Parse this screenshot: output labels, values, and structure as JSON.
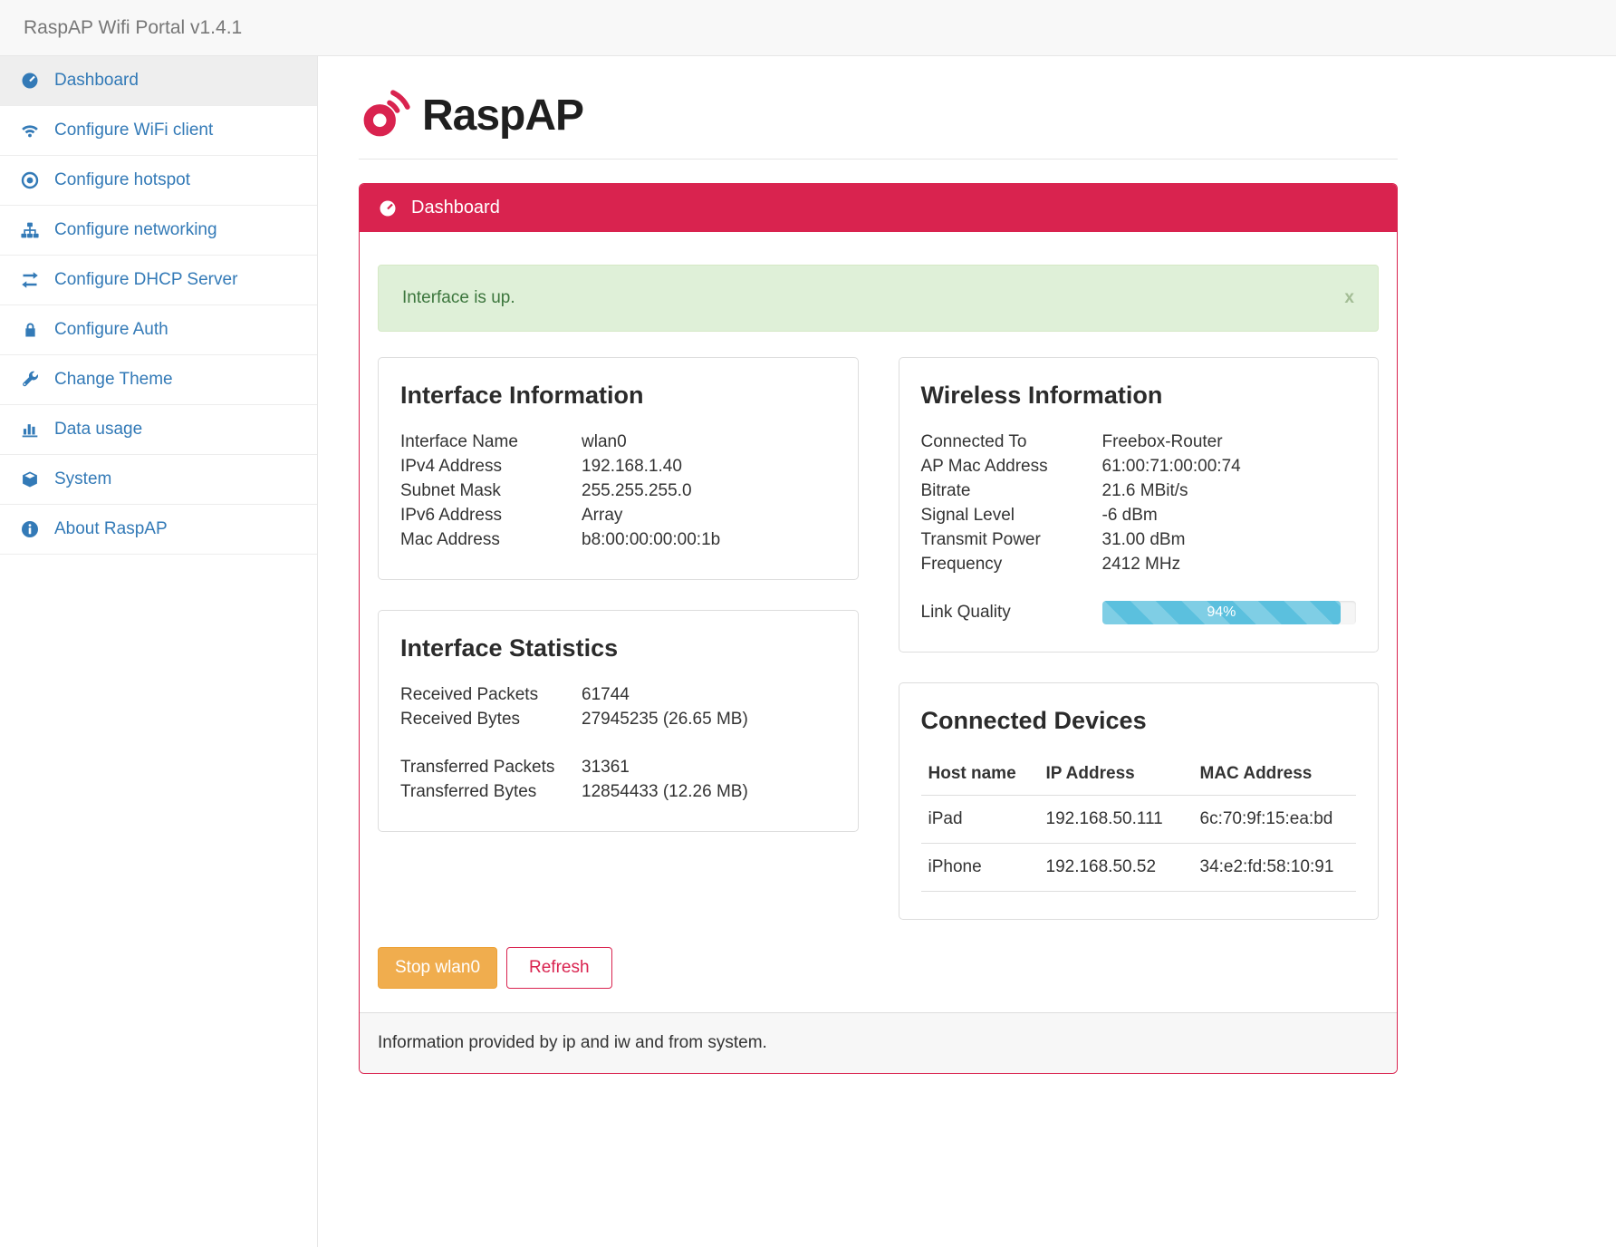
{
  "colors": {
    "brand_red": "#d9234f",
    "sidebar_link_blue": "#337ab7",
    "alert_success_bg": "#dff0d8",
    "alert_success_text": "#3c763d",
    "warning_orange": "#f0ad4e",
    "progress_blue": "#5bc0de"
  },
  "topbar": {
    "title": "RaspAP Wifi Portal v1.4.1"
  },
  "sidebar": {
    "items": [
      {
        "label": "Dashboard",
        "icon": "gauge-icon",
        "active": true
      },
      {
        "label": "Configure WiFi client",
        "icon": "wifi-icon",
        "active": false
      },
      {
        "label": "Configure hotspot",
        "icon": "dot-circle-icon",
        "active": false
      },
      {
        "label": "Configure networking",
        "icon": "sitemap-icon",
        "active": false
      },
      {
        "label": "Configure DHCP Server",
        "icon": "exchange-icon",
        "active": false
      },
      {
        "label": "Configure Auth",
        "icon": "lock-icon",
        "active": false
      },
      {
        "label": "Change Theme",
        "icon": "wrench-icon",
        "active": false
      },
      {
        "label": "Data usage",
        "icon": "bar-chart-icon",
        "active": false
      },
      {
        "label": "System",
        "icon": "cube-icon",
        "active": false
      },
      {
        "label": "About RaspAP",
        "icon": "info-circle-icon",
        "active": false
      }
    ]
  },
  "brand": {
    "name": "RaspAP"
  },
  "panel": {
    "title": "Dashboard",
    "alert": {
      "message": "Interface is up.",
      "close_label": "x"
    },
    "footer": "Information provided by ip and iw and from system."
  },
  "interface_info": {
    "title": "Interface Information",
    "rows": [
      {
        "label": "Interface Name",
        "value": "wlan0"
      },
      {
        "label": "IPv4 Address",
        "value": "192.168.1.40"
      },
      {
        "label": "Subnet Mask",
        "value": "255.255.255.0"
      },
      {
        "label": "IPv6 Address",
        "value": "Array"
      },
      {
        "label": "Mac Address",
        "value": "b8:00:00:00:00:1b"
      }
    ]
  },
  "interface_stats": {
    "title": "Interface Statistics",
    "rows": [
      {
        "label": "Received Packets",
        "value": "61744"
      },
      {
        "label": "Received Bytes",
        "value": "27945235 (26.65 MB)"
      },
      {
        "label": "Transferred Packets",
        "value": "31361"
      },
      {
        "label": "Transferred Bytes",
        "value": "12854433 (12.26 MB)"
      }
    ]
  },
  "wireless": {
    "title": "Wireless Information",
    "rows": [
      {
        "label": "Connected To",
        "value": "Freebox-Router"
      },
      {
        "label": "AP Mac Address",
        "value": "61:00:71:00:00:74"
      },
      {
        "label": "Bitrate",
        "value": "21.6 MBit/s"
      },
      {
        "label": "Signal Level",
        "value": "-6 dBm"
      },
      {
        "label": "Transmit Power",
        "value": "31.00 dBm"
      },
      {
        "label": "Frequency",
        "value": "2412 MHz"
      }
    ],
    "link_quality": {
      "label": "Link Quality",
      "value": 94,
      "display": "94%"
    }
  },
  "devices": {
    "title": "Connected Devices",
    "headers": [
      "Host name",
      "IP Address",
      "MAC Address"
    ],
    "rows": [
      [
        "iPad",
        "192.168.50.111",
        "6c:70:9f:15:ea:bd"
      ],
      [
        "iPhone",
        "192.168.50.52",
        "34:e2:fd:58:10:91"
      ]
    ]
  },
  "actions": {
    "stop": "Stop wlan0",
    "refresh": "Refresh"
  }
}
